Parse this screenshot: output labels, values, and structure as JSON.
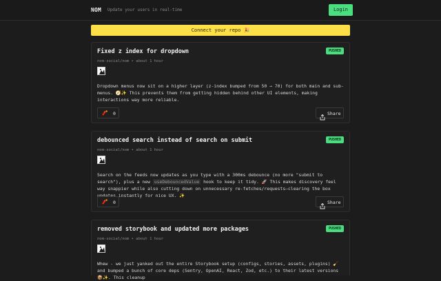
{
  "header": {
    "brand": "NOM",
    "tagline": "Update your users in real-time",
    "login_label": "Login"
  },
  "banner": {
    "text": "Connect your repo 🎉"
  },
  "posts": [
    {
      "title": "Fixed z index for dropdown",
      "badge": "PUSHED",
      "meta": "nom-social/nom • about 1 hour",
      "description": "Dropdown menus now sit on a higher layer (z-index bumped from 50 → 70) for both main and sub-menus. 🧭✨ This prevents them from getting hidden behind other UI elements, making interactions way more reliable.",
      "likes": "0",
      "share_label": "Share"
    },
    {
      "title": "debounced search instead of search on submit",
      "badge": "PUSHED",
      "meta": "nom-social/nom • about 1 hour",
      "description_before": "Search on the feeds now updates as you type with a 300ms debounce (no more \"submit to search\"), plus a new ",
      "description_code": "useDebouncedValue",
      "description_after": " hook to keep it tidy. 🚀 This makes discovery feel way snappier while also cutting down on unnecessary re-fetches/requests—clearing the box updates instantly for nice UX. ✨",
      "likes": "0",
      "share_label": "Share"
    },
    {
      "title": "removed storybook and updated more packages",
      "badge": "PUSHED",
      "meta": "nom-social/nom • about 1 hour",
      "description": "Whew - we just yanked out the entire Storybook setup (configs, stories, assets, plugins) 🧹 and bumped a bunch of core deps (Sentry, OpenAI, React, Zod, etc.) to their latest versions 📦✨. This cleanup",
      "likes": "0",
      "share_label": "Share"
    }
  ],
  "colors": {
    "background": "#1c1c1c",
    "accent_green": "#4ade80",
    "banner_yellow": "#fde047"
  },
  "icons": {
    "like": "fire-cracker-icon",
    "share": "share-icon",
    "avatar": "avatar-icon"
  }
}
